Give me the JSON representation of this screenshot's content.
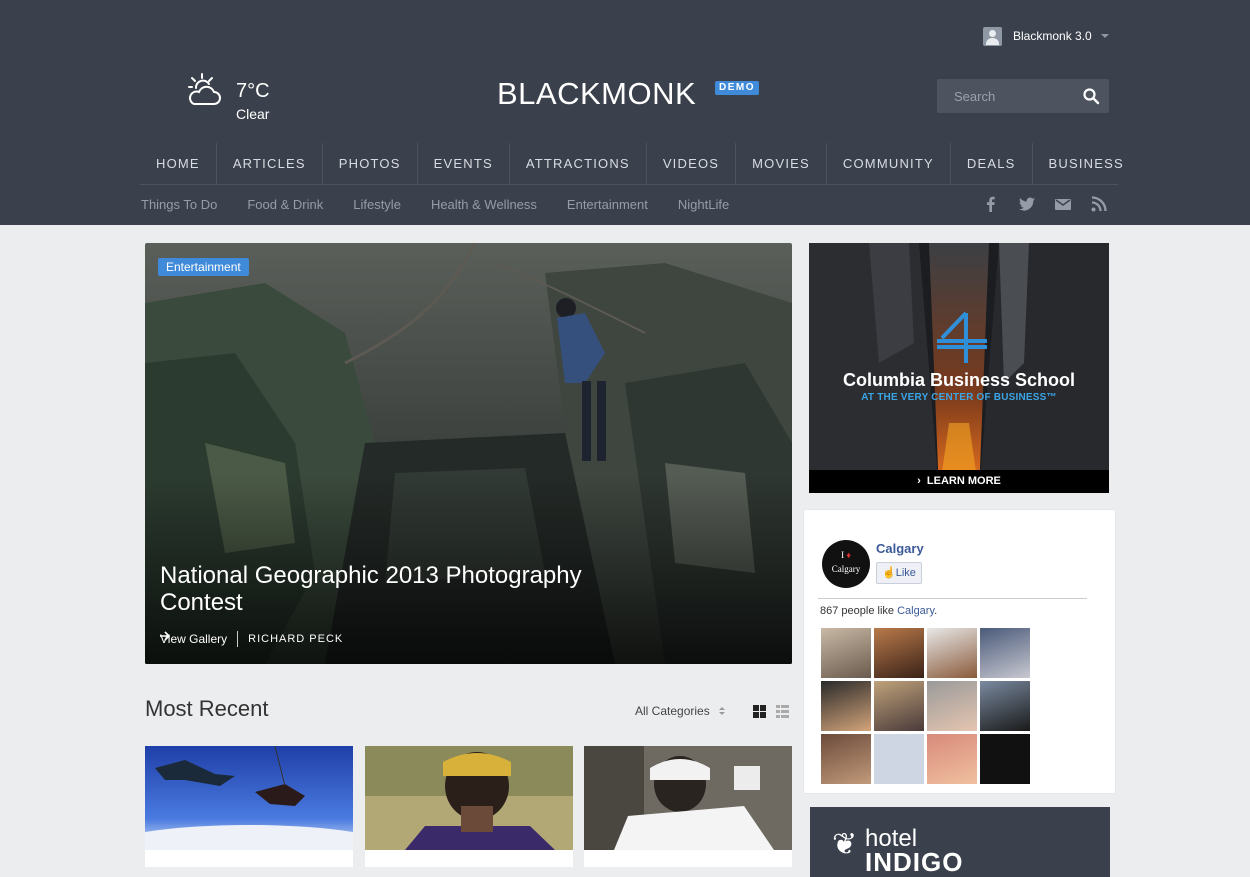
{
  "user": {
    "name": "Blackmonk 3.0"
  },
  "weather": {
    "temperature": "7°C",
    "condition": "Clear"
  },
  "logo": {
    "text": "BLACKMONK",
    "badge": "DEMO"
  },
  "search": {
    "placeholder": "Search"
  },
  "main_nav": [
    "HOME",
    "ARTICLES",
    "PHOTOS",
    "EVENTS",
    "ATTRACTIONS",
    "VIDEOS",
    "MOVIES",
    "COMMUNITY",
    "DEALS",
    "BUSINESS"
  ],
  "sub_nav": [
    "Things To Do",
    "Food & Drink",
    "Lifestyle",
    "Health & Wellness",
    "Entertainment",
    "NightLife"
  ],
  "social_icons": [
    "facebook-icon",
    "twitter-icon",
    "email-icon",
    "rss-icon"
  ],
  "hero": {
    "category": "Entertainment",
    "title": "National Geographic 2013 Photography Contest",
    "gallery_link": "View Gallery",
    "author": "RICHARD PECK"
  },
  "ad": {
    "title": "Columbia Business School",
    "tagline": "AT THE VERY CENTER OF BUSINESS™",
    "cta": "LEARN MORE"
  },
  "facebook": {
    "page_name": "Calgary",
    "logo_line1": "I",
    "logo_line2": "Calgary",
    "like_label": "Like",
    "count_text": "867 people like ",
    "count_link": "Calgary",
    "count_suffix": "."
  },
  "hotel_ad": {
    "line1": "hotel",
    "line2": "INDIGO"
  },
  "most_recent": {
    "title": "Most Recent",
    "category_filter": "All Categories"
  },
  "colors": {
    "header_bg": "#3b414c",
    "accent": "#3f8bd9",
    "facebook_blue": "#3b5998",
    "page_bg": "#ecedef"
  }
}
